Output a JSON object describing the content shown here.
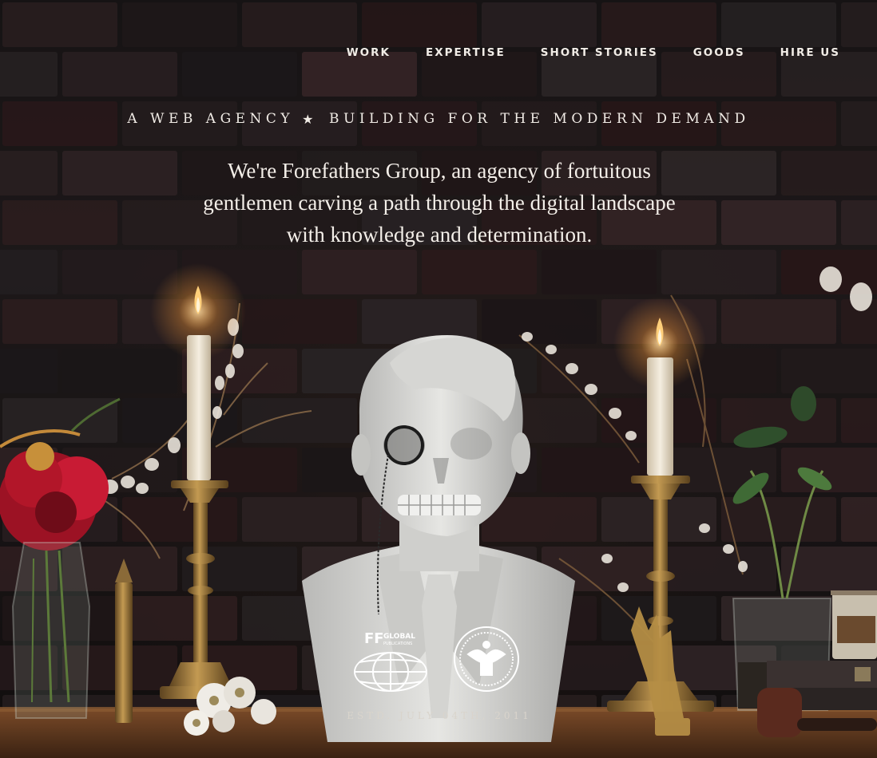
{
  "nav": {
    "items": [
      {
        "label": "WORK"
      },
      {
        "label": "EXPERTISE"
      },
      {
        "label": "SHORT STORIES"
      },
      {
        "label": "GOODS"
      },
      {
        "label": "HIRE US"
      }
    ]
  },
  "hero": {
    "tagline_left": "A WEB AGENCY",
    "tagline_star": "★",
    "tagline_right": "BUILDING FOR THE MODERN DEMAND",
    "intro_line1": "We're Forefathers Group, an agency of fortuitous",
    "intro_line2": "gentlemen carving a path through the digital landscape",
    "intro_line3": "with knowledge and determination.",
    "established": "ESTD. JULY 04TH, 2011",
    "logo_mark": "FF",
    "logo_label": "GLOBAL",
    "logo_sublabel": "PUBLICATIONS"
  },
  "colors": {
    "text": "#f1ece6",
    "wall": "#221d1e",
    "marble": "#dcdcda",
    "brass": "#a07a3a",
    "candle": "#efe6d6",
    "flame": "#ffb84a",
    "flower_red": "#b3162b"
  },
  "icons": {
    "star": "star-icon",
    "globe": "globe-logo-icon",
    "seal": "eagle-seal-icon"
  }
}
